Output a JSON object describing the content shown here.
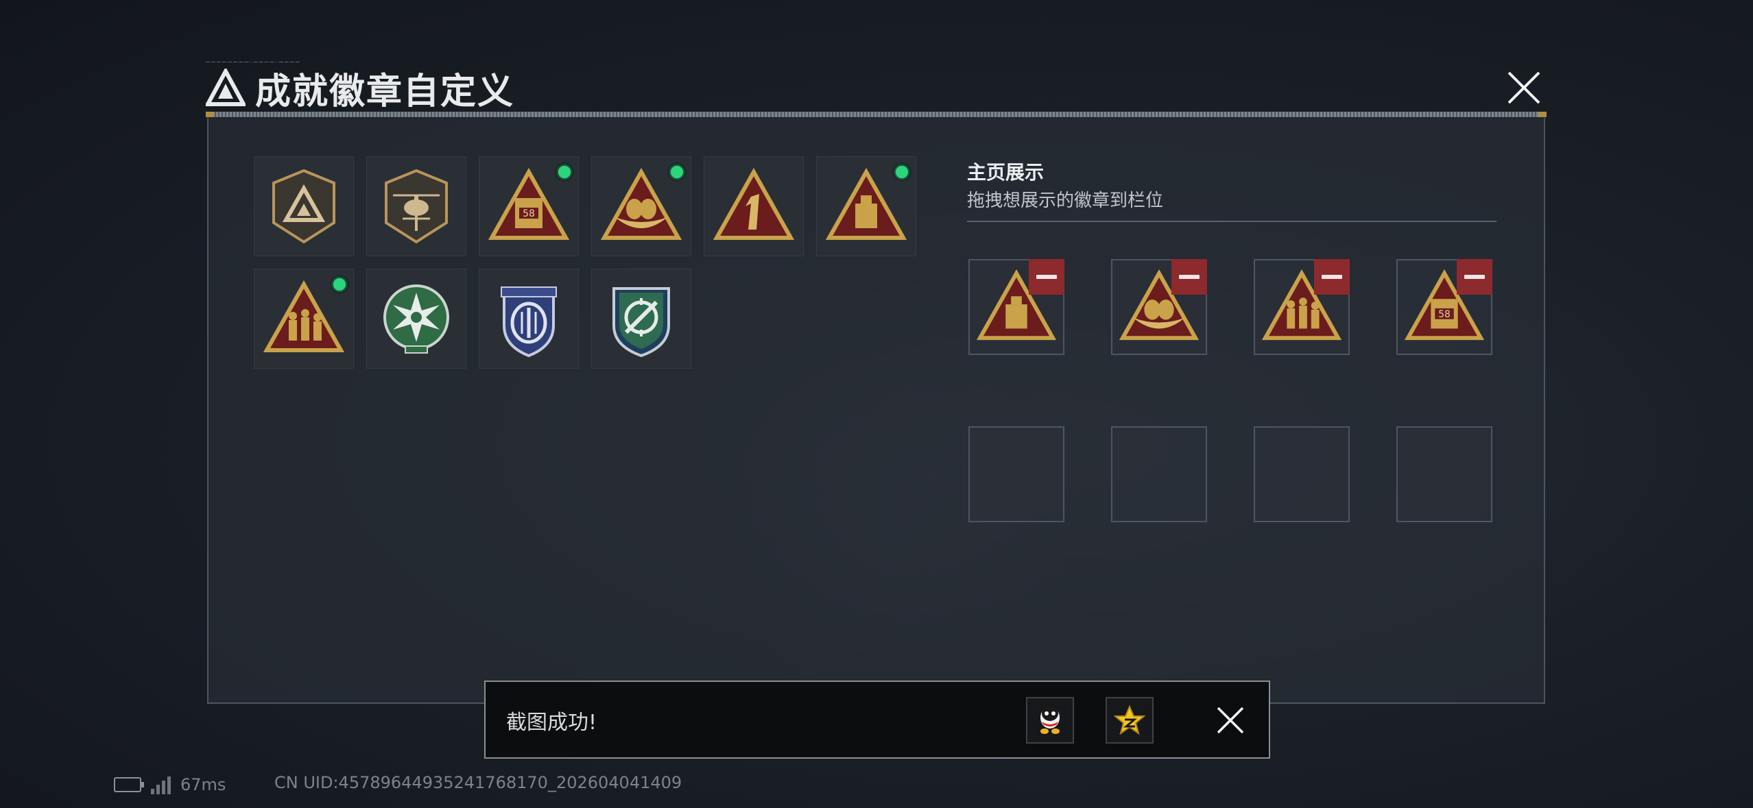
{
  "window": {
    "title": "成就徽章自定义",
    "tiny_caption": "────────·────·────"
  },
  "badge_grid": {
    "items": [
      {
        "icon": "shield-triangle-badge",
        "new": false
      },
      {
        "icon": "helicopter-shield-badge",
        "new": false
      },
      {
        "icon": "cargo-58-triangle-badge",
        "new": true
      },
      {
        "icon": "nest-eggs-triangle-badge",
        "new": true
      },
      {
        "icon": "number-one-triangle-badge",
        "new": false
      },
      {
        "icon": "usb-triangle-badge",
        "new": true
      },
      {
        "icon": "soldiers-triangle-badge",
        "new": true
      },
      {
        "icon": "green-star-emblem-badge",
        "new": false
      },
      {
        "icon": "blue-police-shield-badge",
        "new": false
      },
      {
        "icon": "green-crosshair-shield-badge",
        "new": false
      }
    ]
  },
  "showcase": {
    "title": "主页展示",
    "subtitle": "拖拽想展示的徽章到栏位",
    "slots": [
      {
        "icon": "usb-triangle-badge",
        "filled": true
      },
      {
        "icon": "nest-eggs-triangle-badge",
        "filled": true
      },
      {
        "icon": "soldiers-triangle-badge",
        "filled": true
      },
      {
        "icon": "cargo-58-triangle-badge",
        "filled": true
      },
      {
        "filled": false
      },
      {
        "filled": false
      },
      {
        "filled": false
      },
      {
        "filled": false
      }
    ]
  },
  "toast": {
    "message": "截图成功!",
    "share_buttons": [
      "qq-penguin-icon",
      "qzone-star-icon"
    ]
  },
  "status_bar": {
    "ping": "67ms",
    "uid": "CN UID:4578964493524176817​0_202604041409"
  },
  "colors": {
    "new_dot": "#2bd67b",
    "remove_button": "#8c2a2e",
    "triangle_red": "#6b1c1c",
    "gold": "#c9a24a"
  }
}
